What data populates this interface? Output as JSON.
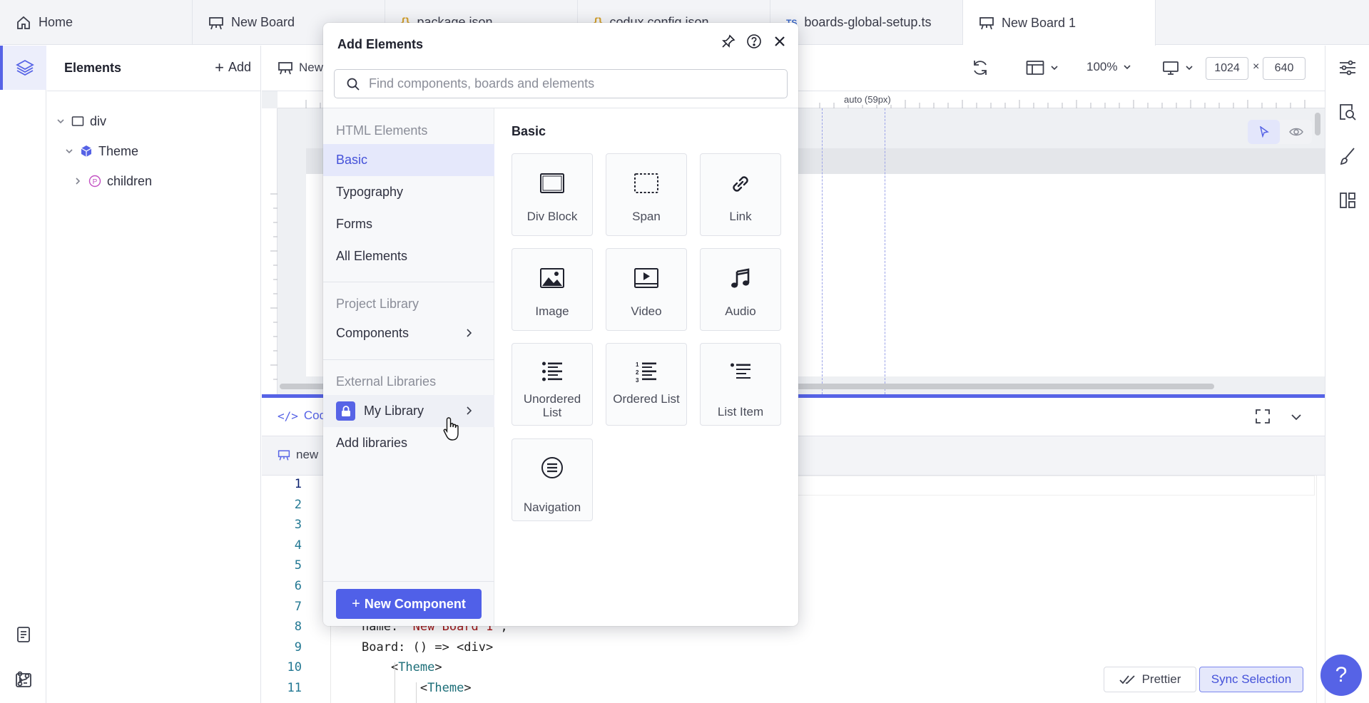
{
  "tabs": [
    {
      "label": "Home",
      "icon": "home-icon"
    },
    {
      "label": "New Board",
      "icon": "board-icon"
    },
    {
      "label": "package.json",
      "icon": "json-icon"
    },
    {
      "label": "codux.config.json",
      "icon": "json-icon"
    },
    {
      "label": "boards-global-setup.ts",
      "icon": "typescript-icon",
      "badge": "TS"
    },
    {
      "label": "New Board 1",
      "icon": "board-icon",
      "active": true
    }
  ],
  "elements_panel": {
    "title": "Elements",
    "add_label": "Add",
    "tree": [
      {
        "label": "div",
        "icon": "div-icon"
      },
      {
        "label": "Theme",
        "icon": "component-icon"
      },
      {
        "label": "children",
        "icon": "prop-icon"
      }
    ]
  },
  "toolbar": {
    "board_label": "New",
    "zoom": "100%",
    "width": "1024",
    "times": "×",
    "height": "640"
  },
  "canvas": {
    "ruler_label": "auto (59px)"
  },
  "code_panel": {
    "title": "Code",
    "file_tab": "new",
    "line_numbers": [
      "1",
      "2",
      "3",
      "4",
      "5",
      "6",
      "7",
      "8",
      "9",
      "10",
      "11"
    ],
    "lines": [
      {
        "n": 8,
        "parts": [
          {
            "t": "name: ",
            "c": ""
          },
          {
            "t": "'New Board 1'",
            "c": "str"
          },
          {
            "t": ",",
            "c": ""
          }
        ]
      },
      {
        "n": 9,
        "parts": [
          {
            "t": "Board: () => <div>",
            "c": ""
          }
        ]
      },
      {
        "n": 10,
        "parts": [
          {
            "t": "    <",
            "c": ""
          },
          {
            "t": "Theme",
            "c": "tag"
          },
          {
            "t": ">",
            "c": ""
          }
        ]
      },
      {
        "n": 11,
        "parts": [
          {
            "t": "        <",
            "c": ""
          },
          {
            "t": "Theme",
            "c": "tag"
          },
          {
            "t": ">",
            "c": ""
          }
        ]
      }
    ],
    "prettier_label": "Prettier",
    "sync_label": "Sync Selection"
  },
  "popover": {
    "title": "Add Elements",
    "search_placeholder": "Find components, boards and elements",
    "sections": {
      "html": "HTML Elements",
      "project": "Project Library",
      "external": "External Libraries"
    },
    "html_items": [
      "Basic",
      "Typography",
      "Forms",
      "All Elements"
    ],
    "selected_item": "Basic",
    "project_items": [
      "Components"
    ],
    "external_items": [
      "My Library",
      "Add libraries"
    ],
    "new_component_label": "New Component",
    "grid_title": "Basic",
    "tiles": [
      {
        "label": "Div Block",
        "icon": "div-block-icon"
      },
      {
        "label": "Span",
        "icon": "span-icon"
      },
      {
        "label": "Link",
        "icon": "link-icon"
      },
      {
        "label": "Image",
        "icon": "image-icon"
      },
      {
        "label": "Video",
        "icon": "video-icon"
      },
      {
        "label": "Audio",
        "icon": "audio-icon"
      },
      {
        "label": "Unordered List",
        "icon": "unordered-list-icon"
      },
      {
        "label": "Ordered List",
        "icon": "ordered-list-icon"
      },
      {
        "label": "List Item",
        "icon": "list-item-icon"
      },
      {
        "label": "Navigation",
        "icon": "navigation-icon"
      }
    ]
  },
  "help_label": "?",
  "colors": {
    "accent": "#5663e6",
    "selected_bg": "#e5e8fb",
    "primary_button": "#5060e8"
  }
}
